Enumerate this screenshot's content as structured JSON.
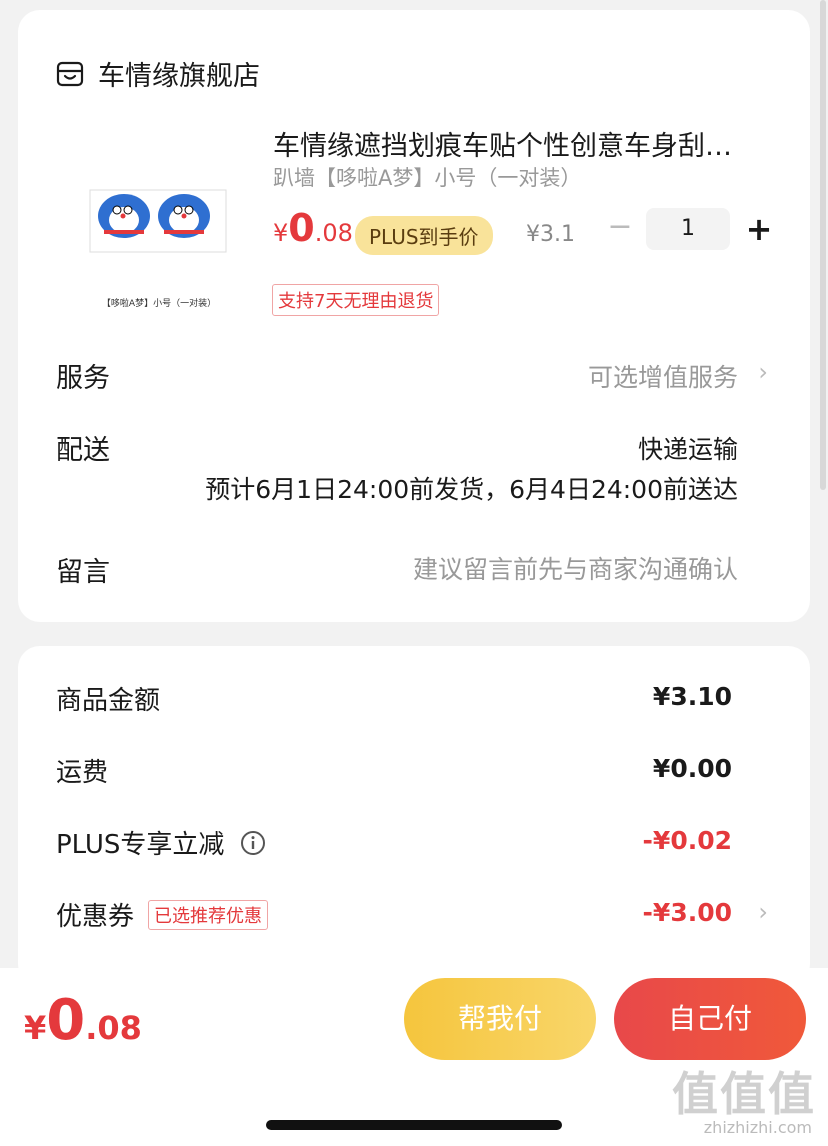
{
  "store": {
    "name": "车情缘旗舰店",
    "icon": "store-icon"
  },
  "product": {
    "title": "车情缘遮挡划痕车贴个性创意车身刮…",
    "spec": "趴墙【哆啦A梦】小号（一对装）",
    "thumb_caption": "【哆啦A梦】小号（一对装）",
    "price_yen": "¥",
    "price_int": "0",
    "price_dec": ".08",
    "plus_badge": "PLUS到手价",
    "orig_price": "¥3.1",
    "qty_minus": "−",
    "quantity": "1",
    "qty_plus": "+",
    "return_policy": "支持7天无理由退货"
  },
  "service": {
    "label": "服务",
    "value": "可选增值服务"
  },
  "delivery": {
    "label": "配送",
    "method": "快递运输",
    "estimate": "预计6月1日24:00前发货，6月4日24:00前送达"
  },
  "message": {
    "label": "留言",
    "placeholder": "建议留言前先与商家沟通确认"
  },
  "amounts": {
    "goods_label": "商品金额",
    "goods_value": "¥3.10",
    "shipping_label": "运费",
    "shipping_value": "¥0.00",
    "plus_label": "PLUS专享立减",
    "plus_value": "-¥0.02",
    "coupon_label": "优惠券",
    "coupon_tag": "已选推荐优惠",
    "coupon_value": "-¥3.00"
  },
  "footer": {
    "total_yen": "¥",
    "total_int": "0",
    "total_dec": ".08",
    "help_pay": "帮我付",
    "self_pay": "自己付"
  },
  "watermark": {
    "logo": "值值值",
    "url": "zhizhizhi.com"
  },
  "colors": {
    "accent_red": "#e4393c",
    "plus_gold": "#f9e39a",
    "help_btn": "#f5c53d",
    "self_btn": "#e8484a"
  }
}
